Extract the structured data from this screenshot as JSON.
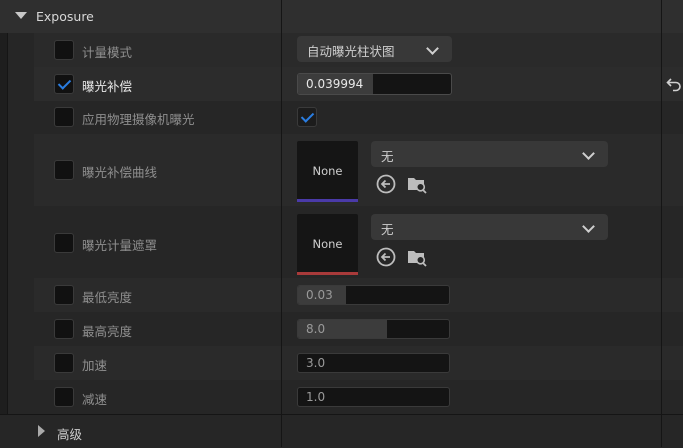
{
  "section": {
    "title": "Exposure"
  },
  "rows": {
    "metering_mode": {
      "label": "计量模式",
      "checked": false,
      "dropdown_value": "自动曝光柱状图"
    },
    "exposure_compensation": {
      "label": "曝光补偿",
      "checked": true,
      "value": "0.039994",
      "fill": 0.49
    },
    "apply_physical_camera": {
      "label": "应用物理摄像机曝光",
      "checked": false,
      "value_checked": true
    },
    "compensation_curve": {
      "label": "曝光补偿曲线",
      "checked": false,
      "thumb_text": "None",
      "asset_value": "无",
      "thumb_color": "#4a3aa8"
    },
    "metering_mask": {
      "label": "曝光计量遮罩",
      "checked": false,
      "thumb_text": "None",
      "asset_value": "无",
      "thumb_color": "#a83a3a"
    },
    "min_brightness": {
      "label": "最低亮度",
      "checked": false,
      "value": "0.03",
      "fill": 0.32
    },
    "max_brightness": {
      "label": "最高亮度",
      "checked": false,
      "value": "8.0",
      "fill": 0.59
    },
    "speed_up": {
      "label": "加速",
      "checked": false,
      "value": "3.0",
      "fill": 0.0
    },
    "speed_down": {
      "label": "减速",
      "checked": false,
      "value": "1.0",
      "fill": 0.0
    }
  },
  "advanced": {
    "title": "高级"
  },
  "icons": {
    "expand": "triangle-down",
    "collapse": "triangle-right",
    "use_selected": "arrow-left-circle",
    "browse": "folder-search",
    "reset": "reset-arrow",
    "dropdown": "chevron-down"
  }
}
